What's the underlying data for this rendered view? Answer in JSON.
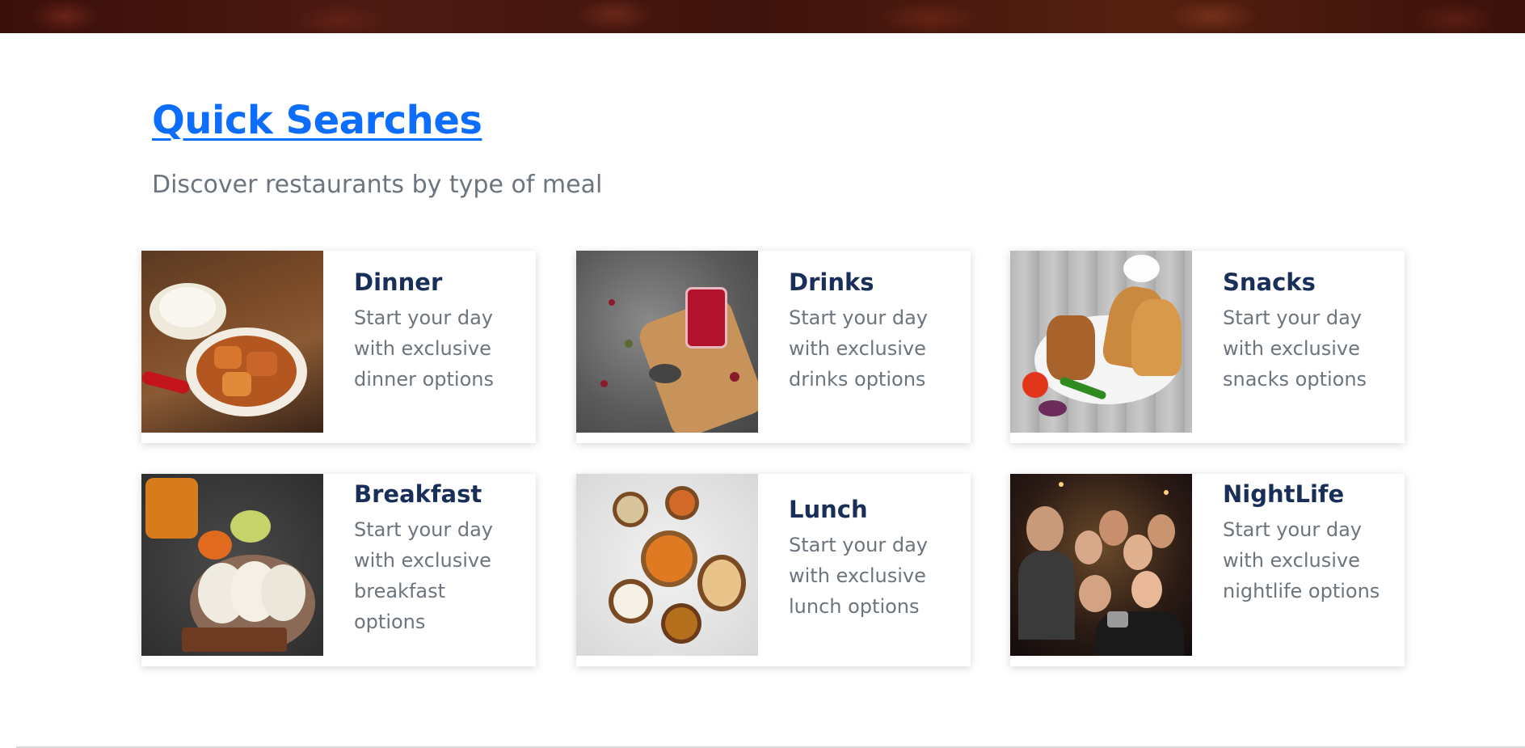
{
  "section": {
    "title": "Quick Searches",
    "subtitle": "Discover restaurants by type of meal"
  },
  "cards": [
    {
      "title": "Dinner",
      "description": "Start your day with exclusive dinner options",
      "image": "dinner-curry-image"
    },
    {
      "title": "Drinks",
      "description": "Start your day with exclusive drinks options",
      "image": "tea-glass-image"
    },
    {
      "title": "Snacks",
      "description": "Start your day with exclusive snacks options",
      "image": "samosa-plate-image"
    },
    {
      "title": "Breakfast",
      "description": "Start your day with exclusive breakfast options",
      "image": "idli-plate-image"
    },
    {
      "title": "Lunch",
      "description": "Start your day with exclusive lunch options",
      "image": "thali-bowls-image"
    },
    {
      "title": "NightLife",
      "description": "Start your day with exclusive nightlife options",
      "image": "party-selfie-image"
    }
  ],
  "colors": {
    "link": "#0d6efd",
    "card_title": "#192f59",
    "muted_text": "#6c757d",
    "hero_strip": "#3a0f0b"
  }
}
